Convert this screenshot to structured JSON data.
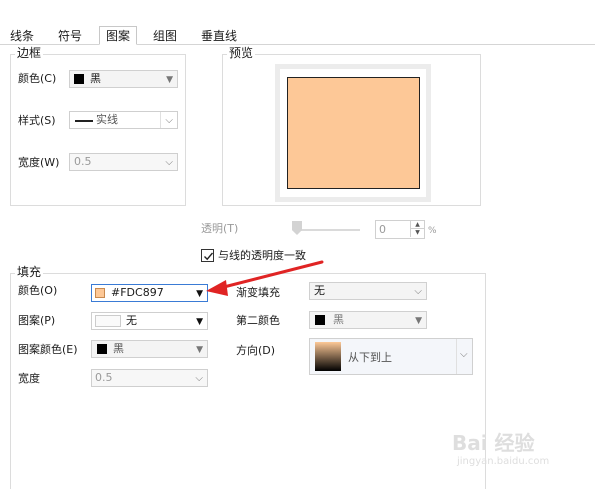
{
  "tabs": [
    {
      "label": "线条"
    },
    {
      "label": "符号"
    },
    {
      "label": "图案"
    },
    {
      "label": "组图"
    },
    {
      "label": "垂直线"
    }
  ],
  "border": {
    "legend": "边框",
    "color_label": "颜色(C)",
    "color_value": "黑",
    "style_label": "样式(S)",
    "style_value": "实线",
    "width_label": "宽度(W)",
    "width_value": "0.5"
  },
  "preview": {
    "legend": "预览",
    "fill_color": "#FDC897"
  },
  "transparency": {
    "label": "透明(T)",
    "value": "0",
    "unit": "%",
    "sync_label": "与线的透明度一致",
    "sync_checked": true
  },
  "fill": {
    "legend": "填充",
    "color_label": "颜色(O)",
    "color_value": "#FDC897",
    "pattern_label": "图案(P)",
    "pattern_value": "无",
    "pattern_color_label": "图案颜色(E)",
    "pattern_color_value": "黑",
    "width_label": "宽度",
    "width_value": "0.5",
    "gradient_label": "渐变填充",
    "gradient_value": "无",
    "second_color_label": "第二颜色",
    "second_color_value": "黑",
    "direction_label": "方向(D)",
    "direction_value": "从下到上"
  },
  "watermark": {
    "main": "Bai 经验",
    "sub": "jingyan.baidu.com"
  }
}
